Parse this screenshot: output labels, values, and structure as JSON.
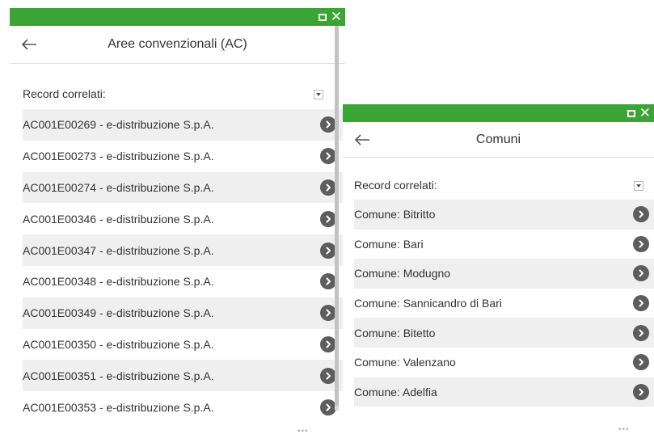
{
  "panel_ac": {
    "title": "Aree convenzionali (AC)",
    "records_label": "Record correlati:",
    "items": [
      "AC001E00269 - e-distribuzione S.p.A.",
      "AC001E00273 - e-distribuzione S.p.A.",
      "AC001E00274 - e-distribuzione S.p.A.",
      "AC001E00346 - e-distribuzione S.p.A.",
      "AC001E00347 - e-distribuzione S.p.A.",
      "AC001E00348 - e-distribuzione S.p.A.",
      "AC001E00349 - e-distribuzione S.p.A.",
      "AC001E00350 - e-distribuzione S.p.A.",
      "AC001E00351 - e-distribuzione S.p.A.",
      "AC001E00353 - e-distribuzione S.p.A."
    ]
  },
  "panel_comuni": {
    "title": "Comuni",
    "records_label": "Record correlati:",
    "items": [
      "Comune: Bitritto",
      "Comune: Bari",
      "Comune: Modugno",
      "Comune: Sannicandro di Bari",
      "Comune: Bitetto",
      "Comune: Valenzano",
      "Comune: Adelfia"
    ]
  },
  "icons": {
    "maximize": "maximize-icon",
    "close": "close-icon",
    "back": "back-arrow-icon",
    "dropdown": "dropdown-icon",
    "go": "chevron-right-circle-icon",
    "more": "more-icon"
  },
  "colors": {
    "titlebar": "#3aa535",
    "row_alt": "#efefef",
    "go_icon": "#5d5d5d"
  }
}
